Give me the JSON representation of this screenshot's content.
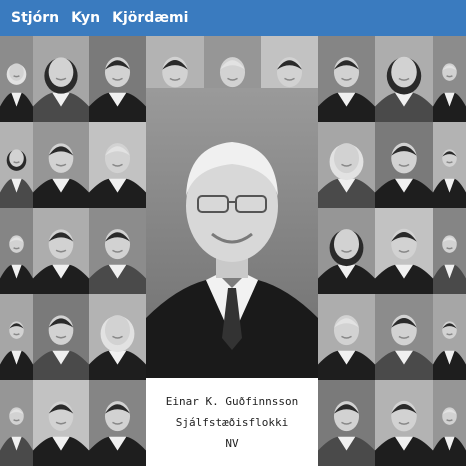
{
  "nav": {
    "items": [
      "Stjórn",
      "Kyn",
      "Kjördæmi"
    ]
  },
  "featured": {
    "name": "Einar K. Guðfinnsson",
    "party": "Sjálfstæðisflokki",
    "district": "NV"
  },
  "colors": {
    "topbar": "#3a7bbf",
    "nav_text": "#ffffff",
    "caption_text": "#222222",
    "photo_light": "#e6e6e6",
    "photo_dark": "#1e1e1e"
  }
}
